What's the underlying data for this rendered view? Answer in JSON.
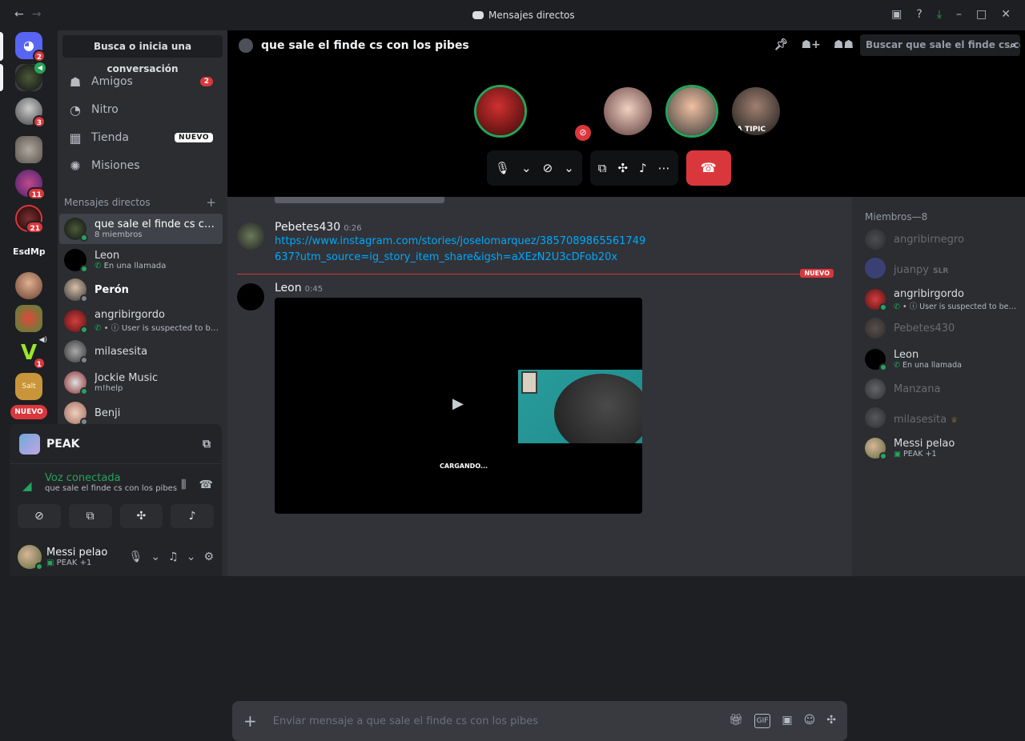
{
  "window": {
    "title": "Mensajes directos"
  },
  "guilds": [
    {
      "name": "home",
      "badge": "2"
    },
    {
      "name": "server-speaker",
      "badge": ""
    },
    {
      "name": "server-3",
      "badge": "3"
    },
    {
      "name": "server-4",
      "badge": ""
    },
    {
      "name": "server-5",
      "badge": "11"
    },
    {
      "name": "server-6",
      "badge": "21"
    },
    {
      "name": "server-esdmp",
      "label": "EsdMp",
      "badge": ""
    },
    {
      "name": "server-8",
      "badge": ""
    },
    {
      "name": "server-9",
      "badge": ""
    },
    {
      "name": "server-10",
      "badge": "1"
    },
    {
      "name": "server-11",
      "badge": ""
    }
  ],
  "guild_new": "NUEVO",
  "sidebar": {
    "search": "Busca o inicia una conversación",
    "nav": [
      {
        "label": "Amigos",
        "count": "2"
      },
      {
        "label": "Nitro"
      },
      {
        "label": "Tienda",
        "tag": "NUEVO"
      },
      {
        "label": "Misiones"
      }
    ],
    "dm_header": "Mensajes directos",
    "dms": [
      {
        "name": "que sale el finde cs con los pibes",
        "sub": "8 miembros"
      },
      {
        "name": "Leon",
        "sub": "En una llamada"
      },
      {
        "name": "Perón",
        "sub": ""
      },
      {
        "name": "angribirgordo",
        "sub": "• ⓘ User is suspected to be a part of an online terrorist organization"
      },
      {
        "name": "milasesita",
        "sub": ""
      },
      {
        "name": "Jockie Music",
        "sub": "m!help"
      },
      {
        "name": "Benji",
        "sub": ""
      }
    ]
  },
  "voice": {
    "activity": "PEAK",
    "status": "Voz conectada",
    "channel": "que sale el finde cs con los pibes"
  },
  "user": {
    "name": "Messi pelao",
    "sub": "PEAK +1"
  },
  "channel": {
    "title": "que sale el finde cs con los pibes",
    "search_placeholder": "Buscar que sale el finde cs con lo..."
  },
  "messages": [
    {
      "author": "Pebetes430",
      "time": "0:26",
      "link": "https://www.instagram.com/stories/joselomarquez/3857089865561749637?utm_source=ig_story_item_share&igsh=aXEzN2U3cDFob20x"
    },
    {
      "author": "Leon",
      "time": "0:45",
      "video_status": "CARGANDO..."
    }
  ],
  "new_marker": "NUEVO",
  "composer": {
    "placeholder": "Enviar mensaje a que sale el finde cs con los pibes"
  },
  "members": {
    "header": "Miembros—8",
    "list": [
      {
        "name": "angribirnegro",
        "sub": "",
        "online": false
      },
      {
        "name": "juanpy",
        "tag": "SLR",
        "sub": "",
        "online": false
      },
      {
        "name": "angribirgordo",
        "sub": "• ⓘ User is suspected to be a part of an online terrorist organization",
        "online": true
      },
      {
        "name": "Pebetes430",
        "sub": "",
        "online": false
      },
      {
        "name": "Leon",
        "sub": "En una llamada",
        "online": true
      },
      {
        "name": "Manzana",
        "sub": "",
        "online": false
      },
      {
        "name": "milasesita",
        "sub": "",
        "online": false
      },
      {
        "name": "Messi pelao",
        "sub": "PEAK +1",
        "online": true
      }
    ]
  },
  "call_participant_caption": "A TIPIC",
  "colors": {
    "accent": "#5865f2",
    "danger": "#da373c",
    "online": "#23a55a",
    "link": "#00a8fc"
  }
}
